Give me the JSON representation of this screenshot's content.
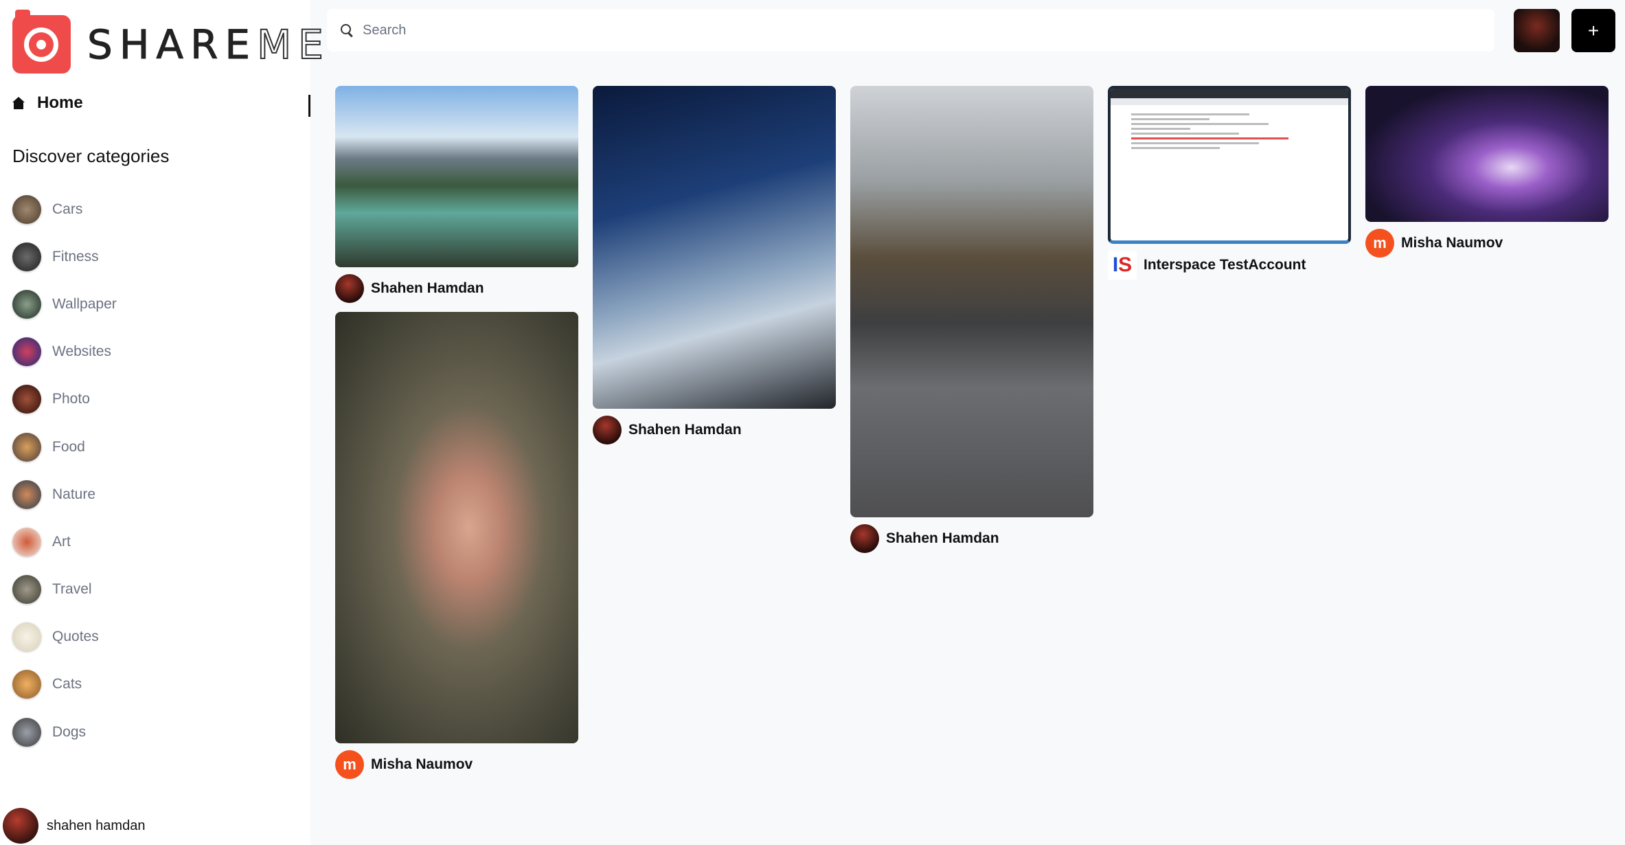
{
  "brand": {
    "name_part1": "SHARE",
    "name_part2": "ME"
  },
  "sidebar": {
    "home_label": "Home",
    "discover_title": "Discover categories",
    "categories": [
      {
        "label": "Cars",
        "color": "#7a6a5a"
      },
      {
        "label": "Fitness",
        "color": "#3a3a3a"
      },
      {
        "label": "Wallpaper",
        "color": "#2f4a3a"
      },
      {
        "label": "Websites",
        "color": "#2a3b8f"
      },
      {
        "label": "Photo",
        "color": "#5a2a1e"
      },
      {
        "label": "Food",
        "color": "#b07a3a"
      },
      {
        "label": "Nature",
        "color": "#5a6a7a"
      },
      {
        "label": "Art",
        "color": "#c0502a"
      },
      {
        "label": "Travel",
        "color": "#6a6a5a"
      },
      {
        "label": "Quotes",
        "color": "#e8e2d0"
      },
      {
        "label": "Cats",
        "color": "#c8862a"
      },
      {
        "label": "Dogs",
        "color": "#6a6a6a"
      }
    ],
    "user_name": "shahen hamdan"
  },
  "header": {
    "search_placeholder": "Search",
    "add_label": "+"
  },
  "pins": [
    {
      "owner": "Shahen Hamdan",
      "avatar_type": "photo"
    },
    {
      "owner": "Misha Naumov",
      "avatar_letter": "m"
    },
    {
      "owner": "Shahen Hamdan",
      "avatar_type": "photo"
    },
    {
      "owner": "Shahen Hamdan",
      "avatar_type": "photo"
    },
    {
      "owner": "Interspace TestAccount",
      "avatar_letters": [
        "I",
        "S"
      ]
    },
    {
      "owner": "Misha Naumov",
      "avatar_letter": "m"
    }
  ]
}
